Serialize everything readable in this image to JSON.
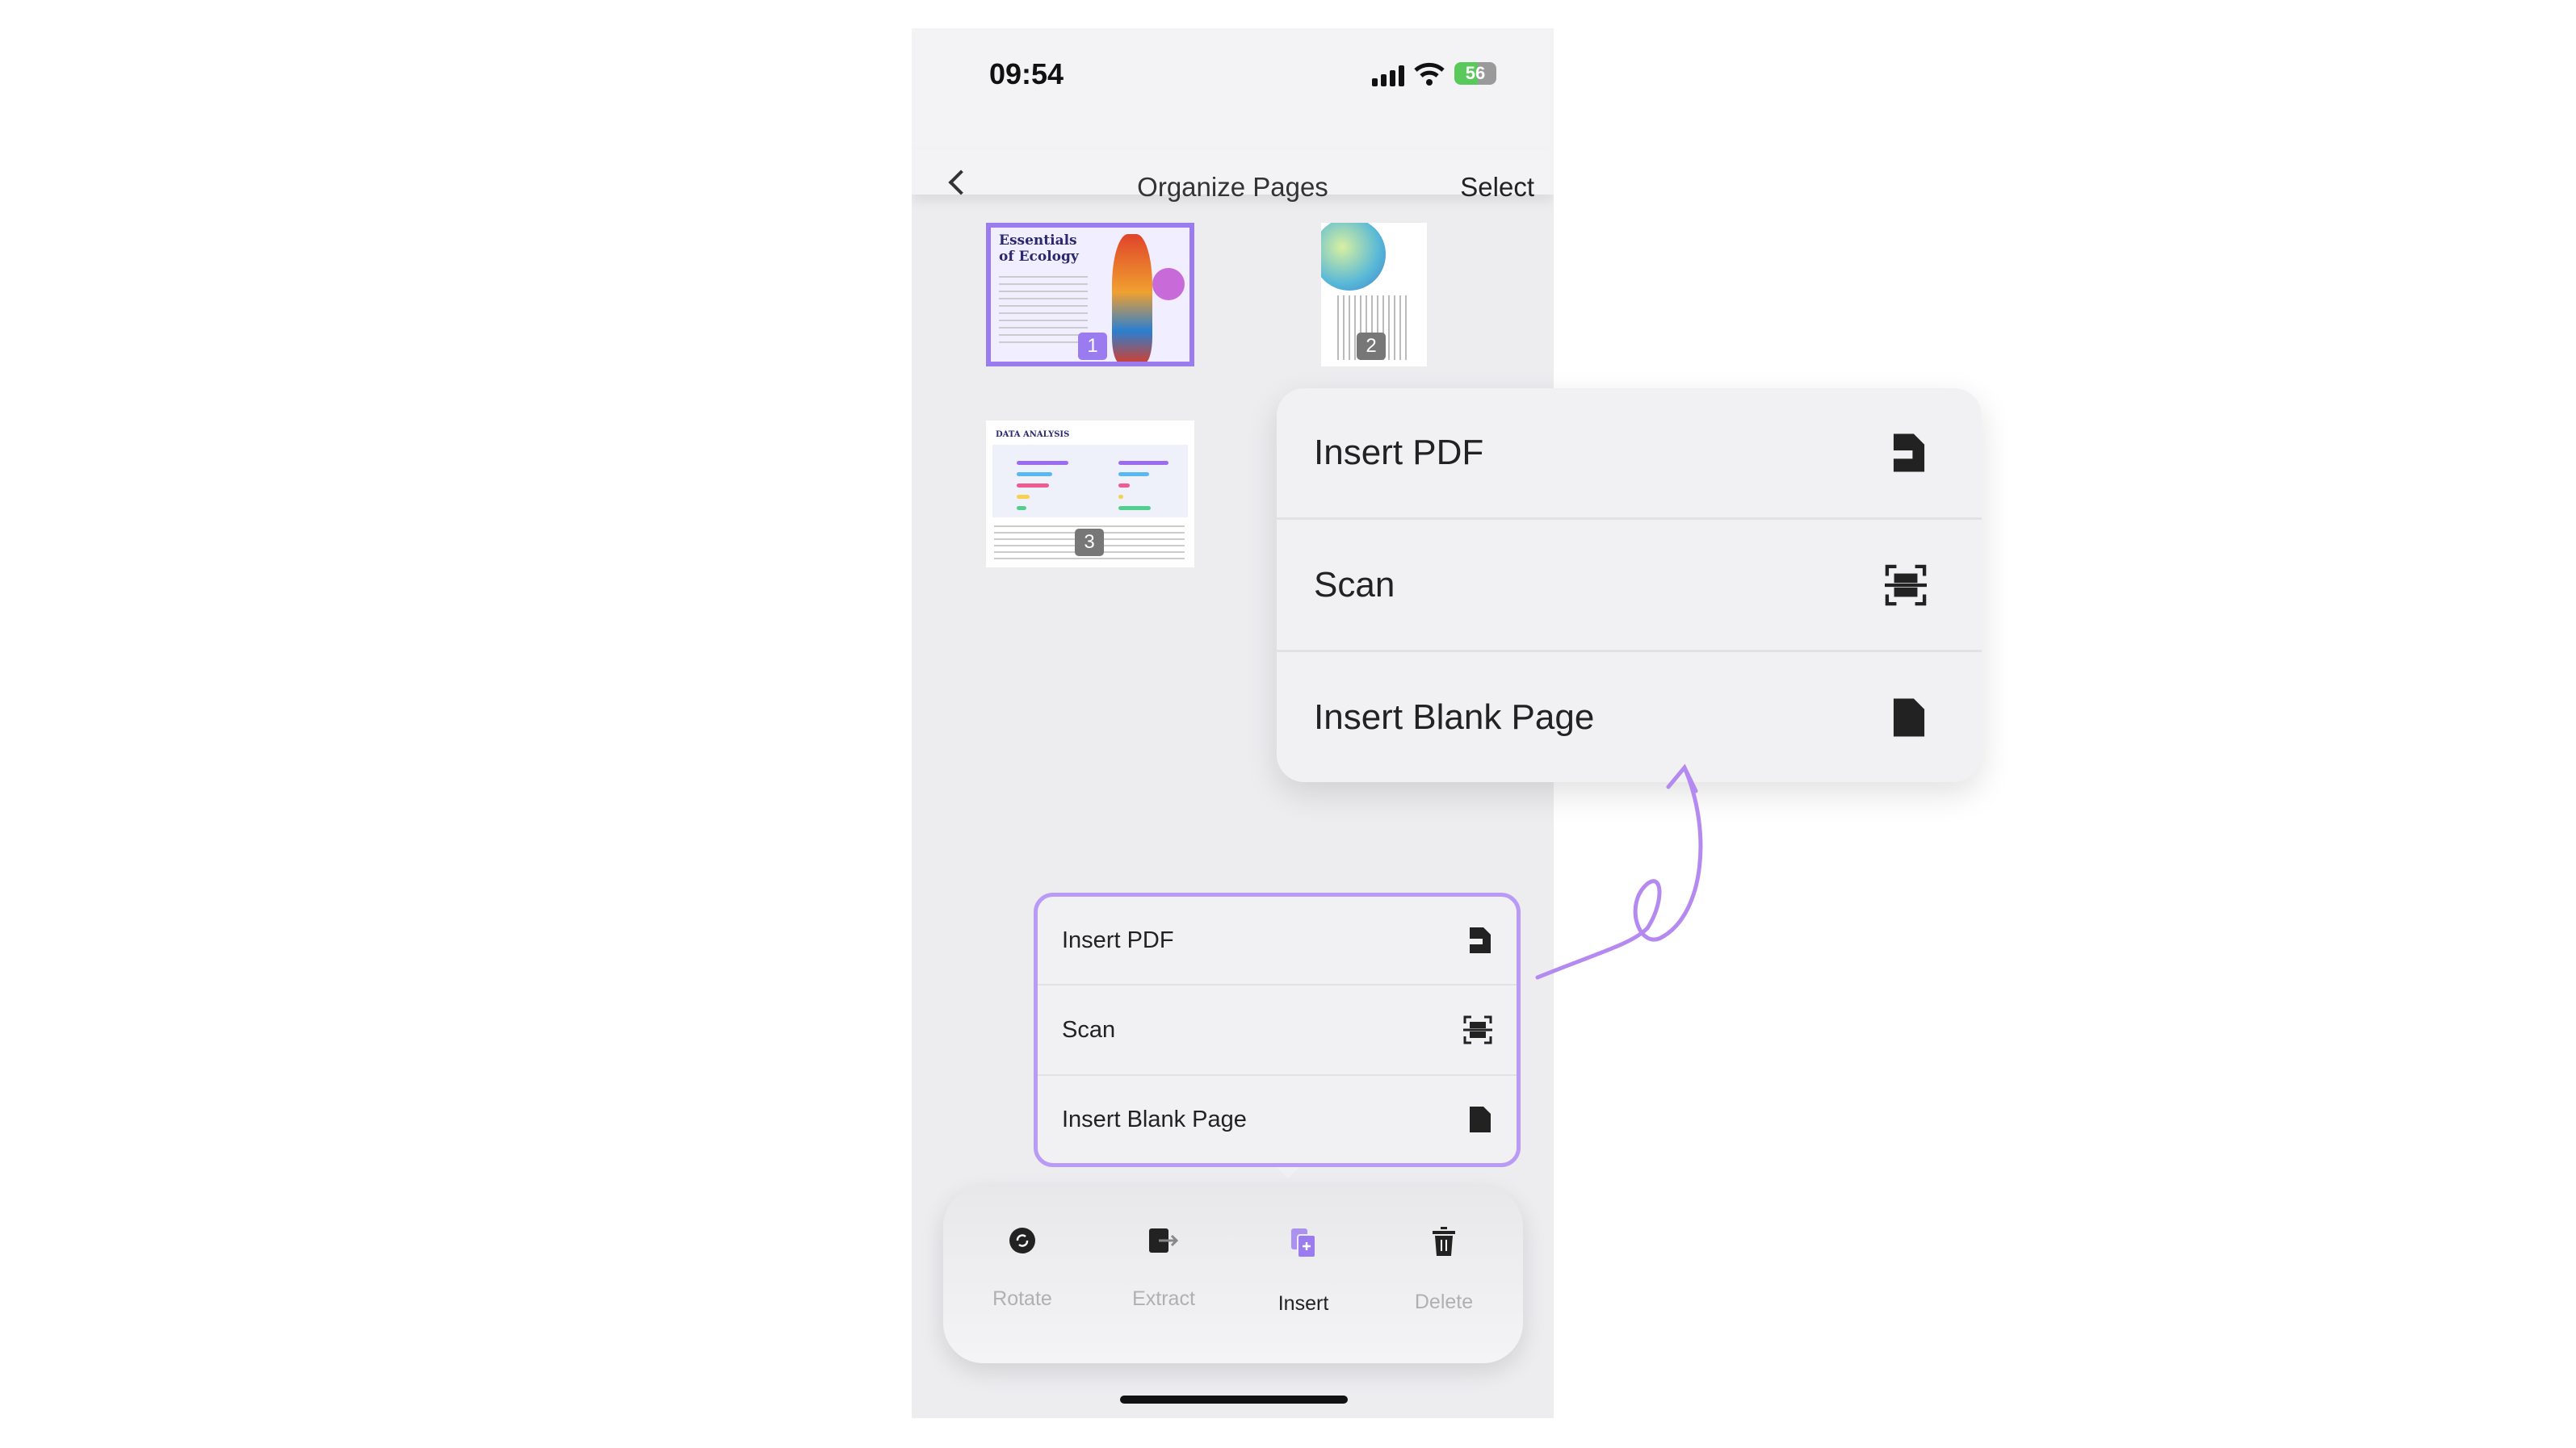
{
  "status_bar": {
    "time": "09:54",
    "battery": "56"
  },
  "nav": {
    "title": "Organize Pages",
    "select_label": "Select"
  },
  "pages": [
    {
      "number": "1",
      "title_line1": "Essentials",
      "title_line2": "of Ecology",
      "selected": true
    },
    {
      "number": "2",
      "selected": false
    },
    {
      "number": "3",
      "heading": "DATA ANALYSIS",
      "selected": false
    }
  ],
  "insert_menu": {
    "items": [
      {
        "label": "Insert PDF",
        "icon": "pdf-file-icon"
      },
      {
        "label": "Scan",
        "icon": "scan-icon"
      },
      {
        "label": "Insert Blank Page",
        "icon": "blank-page-icon"
      }
    ]
  },
  "toolbar": {
    "items": [
      {
        "label": "Rotate",
        "icon": "rotate-icon",
        "active": false
      },
      {
        "label": "Extract",
        "icon": "extract-icon",
        "active": false
      },
      {
        "label": "Insert",
        "icon": "insert-icon",
        "active": true
      },
      {
        "label": "Delete",
        "icon": "trash-icon",
        "active": false
      }
    ]
  },
  "colors": {
    "accent": "#9b7cf0",
    "active_text": "#222222",
    "inactive_text": "#b0b0b0"
  }
}
